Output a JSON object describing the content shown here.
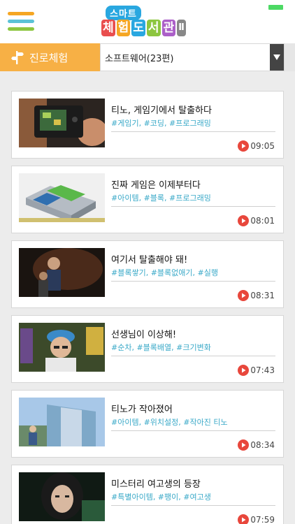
{
  "header": {
    "logo_top": "스마트",
    "logo_chars": [
      "체",
      "험",
      "도",
      "서",
      "관",
      "Ⅱ"
    ]
  },
  "category": {
    "tab_label": "진로체험",
    "select_value": "소프트웨어(23편)"
  },
  "videos": [
    {
      "title": "티노, 게임기에서 탈출하다",
      "tags": "#게임기, #코딩, #프로그래밍",
      "duration": "09:05"
    },
    {
      "title": "진짜 게임은 이제부터다",
      "tags": "#아이템, #블록, #프로그래밍",
      "duration": "08:01"
    },
    {
      "title": "여기서 탈출해야 돼!",
      "tags": "#블록쌓기, #블록없애기, #실행",
      "duration": "08:31"
    },
    {
      "title": "선생님이 이상해!",
      "tags": "#순차, #블록배열, #크기변화",
      "duration": "07:43"
    },
    {
      "title": "티노가 작아졌어",
      "tags": "#아이템, #위치설정, #작아진 티노",
      "duration": "08:34"
    },
    {
      "title": "미스터리 여고생의 등장",
      "tags": "#특별아이템, #팽이, #여고생",
      "duration": "07:59"
    }
  ],
  "colors": {
    "accent_orange": "#f7b045",
    "tag_blue": "#3aa9c8",
    "play_red": "#e8473c"
  },
  "icons": {
    "menu": "hamburger-icon",
    "category": "signpost-icon",
    "dropdown": "triangle-down-icon",
    "play": "play-circle-icon"
  }
}
